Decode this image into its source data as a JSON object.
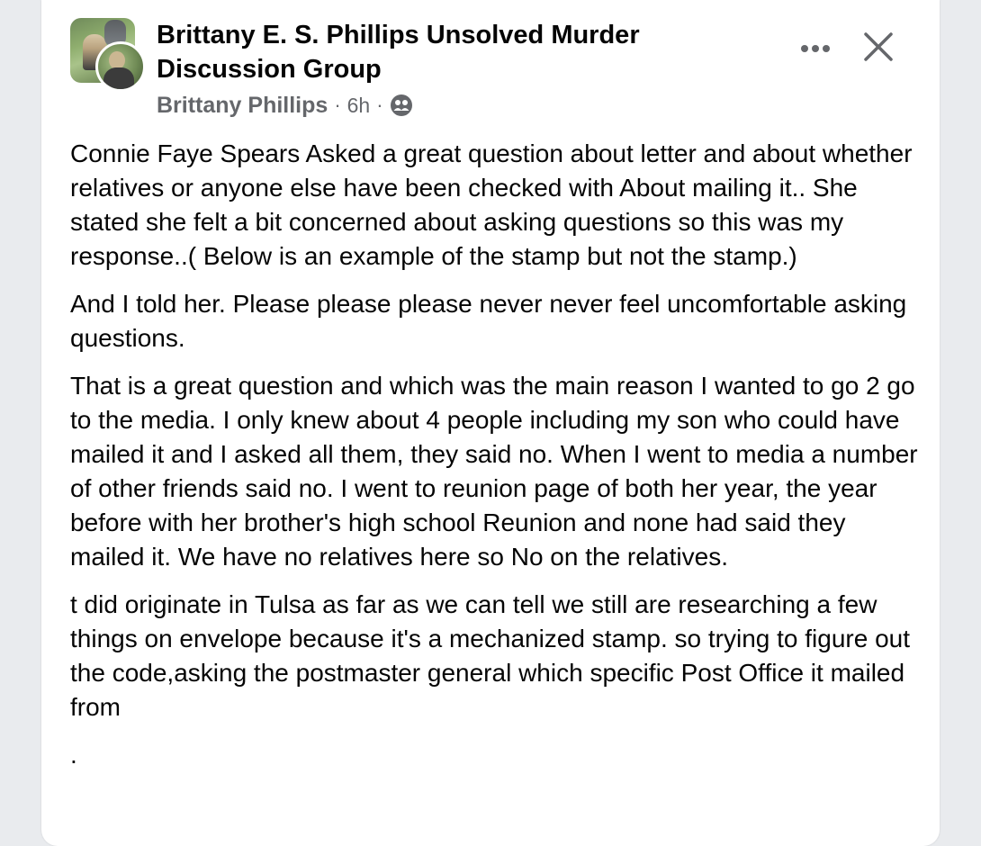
{
  "post": {
    "group_name": "Brittany E. S. Phillips Unsolved Murder Discussion Group",
    "author": "Brittany Phillips",
    "time": "6h",
    "separator": "·",
    "paragraphs": [
      "Connie Faye Spears Asked a great question about letter and about whether relatives or anyone else have been checked with About mailing it.. She stated she felt a bit concerned about asking questions so this was my response..( Below is an example of the stamp but not the stamp.)",
      "And I told her. Please please please never never feel uncomfortable asking questions.",
      "That is a great question and which was the main reason I wanted to go 2 go to the media. I only knew about 4 people including my son who could have mailed it and I asked all them, they said no. When I went to media a number of other friends said no. I went to reunion page of both her year, the year before with her brother's high school Reunion and none had said they mailed it. We have no relatives here so No on the relatives.",
      "t did originate in Tulsa as far as we can tell we still are researching a few things on envelope because it's a mechanized stamp. so trying to figure out the code,asking the postmaster general which specific Post Office it mailed from",
      "."
    ]
  },
  "icons": {
    "privacy": "group-members-icon",
    "more": "more-horizontal-icon",
    "close": "close-icon"
  },
  "colors": {
    "text_primary": "#050505",
    "text_secondary": "#65676b",
    "card_background": "#ffffff",
    "page_background": "#e9ebee"
  }
}
